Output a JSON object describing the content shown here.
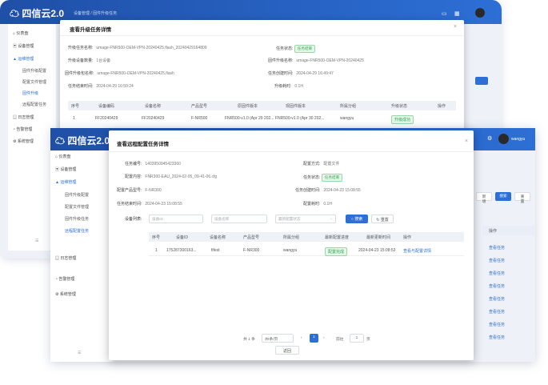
{
  "back_window": {
    "app_title": "四信云2.0",
    "breadcrumb": "设备管理 / 固件升级任务",
    "sidebar": [
      {
        "label": "仪表盘"
      },
      {
        "label": "设备管理"
      },
      {
        "label": "运维管理"
      },
      {
        "label": "固件升级配置"
      },
      {
        "label": "配置文件管理"
      },
      {
        "label": "固件升级"
      },
      {
        "label": "远程配置任务"
      },
      {
        "label": "日志管理"
      },
      {
        "label": "告警管理"
      },
      {
        "label": "系统管理"
      }
    ]
  },
  "modal1": {
    "title": "查看升级任务详情",
    "fields": [
      {
        "label": "升级任务名称:",
        "value": "umage-FNR500-OEM-VPN-20240425.flash_20240429164809"
      },
      {
        "label": "任务状态:",
        "value": "任务结束"
      },
      {
        "label": "升级设备数量:",
        "value": "1台设备"
      },
      {
        "label": "固件升级名称:",
        "value": "umage-FNR500-OEM-VPN-20240425"
      },
      {
        "label": "固件升级包名称:",
        "value": "umage-FNR500-OEM-VPN-20240425.flash"
      },
      {
        "label": "任务创建时间:",
        "value": "2024-04-29 16:49:47"
      },
      {
        "label": "任务结束时间:",
        "value": "2024-04-29 16:50:24"
      },
      {
        "label": "升级耗时:",
        "value": "0.1H"
      }
    ],
    "table": {
      "headers": [
        "序号",
        "设备编码",
        "设备名称",
        "产品型号",
        "原固件版本",
        "现固件版本",
        "所属分组",
        "升级状态",
        "操作"
      ],
      "rows": [
        [
          "1",
          "FF20240429",
          "FF20240429",
          "F-NR500",
          "FNR500-v1.0 (Apr 29 202...",
          "FNR500-v1.0 (Apr 30 202...",
          "wangyu",
          "升级成功",
          ""
        ]
      ]
    }
  },
  "front_window": {
    "app_title": "四信云2.0",
    "user": "wangyu",
    "sidebar": [
      {
        "label": "仪表盘"
      },
      {
        "label": "设备管理"
      },
      {
        "label": "运维管理"
      },
      {
        "label": "固件升级配置"
      },
      {
        "label": "配置文件管理"
      },
      {
        "label": "固件升级任务"
      },
      {
        "label": "远程配置任务"
      },
      {
        "label": "日志管理"
      },
      {
        "label": "告警管理"
      },
      {
        "label": "系统管理"
      }
    ],
    "right_buttons": [
      "新增",
      "搜索",
      "重置"
    ],
    "right_col_header": "操作",
    "right_col_links": [
      "查看任务",
      "查看任务",
      "查看任务",
      "查看任务",
      "查看任务",
      "查看任务",
      "查看任务",
      "查看任务",
      "查看任务",
      "查看任务"
    ]
  },
  "modal2": {
    "title": "查看远程配置任务详情",
    "fields": [
      {
        "label": "任务编号:",
        "value": "1403950945423360"
      },
      {
        "label": "配置方式:",
        "value": "配置文件"
      },
      {
        "label": "配置内容:",
        "value": "FNR300-EAU_2024-02-05_09-41-06.cfg"
      },
      {
        "label": "任务状态:",
        "value": "任务结束"
      },
      {
        "label": "配置产品型号:",
        "value": "F-NR300"
      },
      {
        "label": "任务创建时间:",
        "value": "2024-04-23 15:08:55"
      },
      {
        "label": "任务结束时间:",
        "value": "2024-04-23 15:08:55"
      },
      {
        "label": "配置耗时:",
        "value": "0.1H"
      }
    ],
    "device_list_label": "设备列表:",
    "filters": {
      "device_id_placeholder": "设备ID",
      "device_name_placeholder": "设备名称",
      "status_placeholder": "最新配置状态",
      "search_label": "搜索",
      "reset_label": "重置"
    },
    "table": {
      "headers": [
        "序号",
        "设备ID",
        "设备名称",
        "产品型号",
        "所属分组",
        "最新配置进度",
        "最新更新时间",
        "操作"
      ],
      "rows": [
        [
          "1",
          "175287300163...",
          "fifest",
          "F-NR300",
          "wangyu",
          "配置完成",
          "2024-04-23 15:08:53",
          "查看与配置详情"
        ]
      ]
    },
    "pagination": {
      "total": "共 1 条",
      "page_size": "10条/页",
      "prev": "‹",
      "current": "1",
      "next": "›",
      "goto_label": "前往",
      "goto_value": "1",
      "page_suffix": "页"
    },
    "back_button": "返回"
  }
}
